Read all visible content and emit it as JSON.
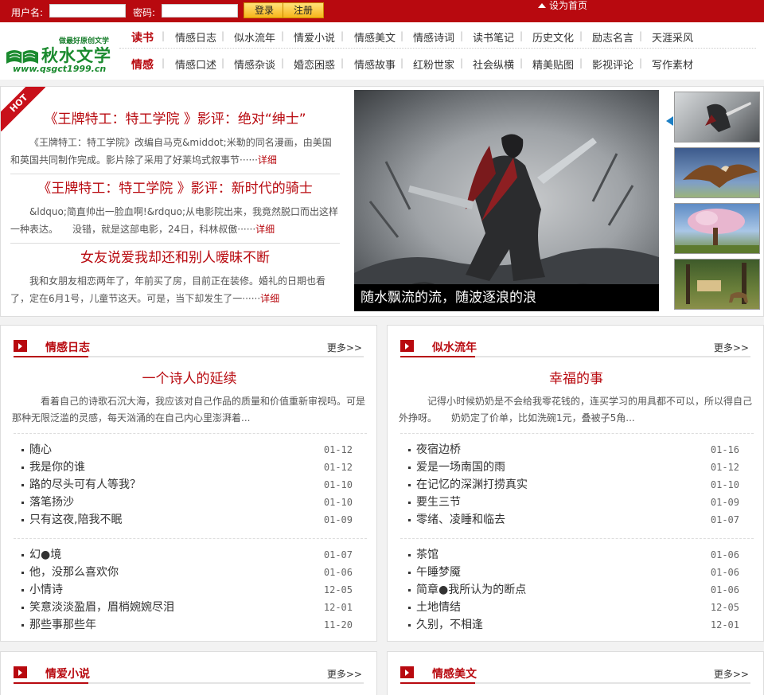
{
  "topbar": {
    "username_label": "用户名:",
    "username_value": "",
    "password_label": "密码:",
    "password_value": "",
    "login_label": "登录",
    "register_label": "注册",
    "home_label": "设为首页"
  },
  "logo": {
    "slogan": "做最好原创文学",
    "name": "秋水文学",
    "url": "www.qsgct1999.cn"
  },
  "nav": {
    "row1": {
      "category": "读书",
      "items": [
        "情感日志",
        "似水流年",
        "情爱小说",
        "情感美文",
        "情感诗词",
        "读书笔记",
        "历史文化",
        "励志名言",
        "天涯采风"
      ]
    },
    "row2": {
      "category": "情感",
      "items": [
        "情感口述",
        "情感杂谈",
        "婚恋困惑",
        "情感故事",
        "红粉世家",
        "社会纵横",
        "精美贴图",
        "影视评论",
        "写作素材"
      ]
    }
  },
  "hero": {
    "hot_label": "HOT",
    "stories": [
      {
        "title": "《王牌特工：特工学院 》影评：绝对“绅士”",
        "desc": "《王牌特工：特工学院》改编自马克&middot;米勒的同名漫画，由美国和英国共同制作完成。影片除了采用了好莱坞式叙事节······",
        "more": "详细"
      },
      {
        "title": "《王牌特工：特工学院 》影评：新时代的骑士",
        "desc": "&ldquo;简直帅出一脸血啊!&rdquo;从电影院出来，我竟然脱口而出这样一种表达。　　没错，就是这部电影，24日，科林叔傲······",
        "more": "详细"
      },
      {
        "title": "女友说爱我却还和别人暧昧不断",
        "desc": "我和女朋友相恋两年了，年前买了房，目前正在装修。婚礼的日期也看了，定在6月1号，儿童节这天。可是，当下却发生了一······",
        "more": "详细"
      }
    ],
    "caption": "随水飘流的流，随波逐浪的浪"
  },
  "sections": [
    {
      "title": "情感日志",
      "more": "更多>>",
      "feature_title": "一个诗人的延续",
      "feature_desc": "看着自己的诗歌石沉大海，我应该对自己作品的质量和价值重新审视吗。可是那种无限泛滥的灵感，每天汹涌的在自己内心里澎湃着...",
      "list1": [
        {
          "title": "随心",
          "date": "01-12"
        },
        {
          "title": "我是你的谁",
          "date": "01-12"
        },
        {
          "title": "路的尽头可有人等我？",
          "date": "01-10"
        },
        {
          "title": "落笔扬沙",
          "date": "01-10"
        },
        {
          "title": "只有这夜,陪我不眠",
          "date": "01-09"
        }
      ],
      "list2": [
        {
          "title": "幻●境",
          "date": "01-07"
        },
        {
          "title": "他，没那么喜欢你",
          "date": "01-06"
        },
        {
          "title": "小情诗",
          "date": "12-05"
        },
        {
          "title": "笑意淡淡盈眉，眉梢婉婉尽泪",
          "date": "12-01"
        },
        {
          "title": "那些事那些年",
          "date": "11-20"
        }
      ]
    },
    {
      "title": "似水流年",
      "more": "更多>>",
      "feature_title": "幸福的事",
      "feature_desc": "记得小时候奶奶是不会给我零花钱的，连买学习的用具都不可以，所以得自己外挣呀。　　奶奶定了价单，比如洗碗1元，叠被子5角...",
      "list1": [
        {
          "title": "夜宿边桥",
          "date": "01-16"
        },
        {
          "title": "爱是一场南国的雨",
          "date": "01-12"
        },
        {
          "title": "在记忆的深渊打捞真实",
          "date": "01-10"
        },
        {
          "title": "要生三节",
          "date": "01-09"
        },
        {
          "title": "零绪、凌睡和临去",
          "date": "01-07"
        }
      ],
      "list2": [
        {
          "title": "茶馆",
          "date": "01-06"
        },
        {
          "title": "午睡梦魇",
          "date": "01-06"
        },
        {
          "title": "简章●我所认为的断点",
          "date": "01-06"
        },
        {
          "title": "土地情结",
          "date": "12-05"
        },
        {
          "title": "久别，不相逢",
          "date": "12-01"
        }
      ]
    },
    {
      "title": "情爱小说",
      "more": "更多>>"
    },
    {
      "title": "情感美文",
      "more": "更多>>"
    }
  ],
  "colors": {
    "brand_red": "#b8090f",
    "logo_green": "#1a8a2e",
    "thumb_arrow": "#1c7fc4"
  }
}
